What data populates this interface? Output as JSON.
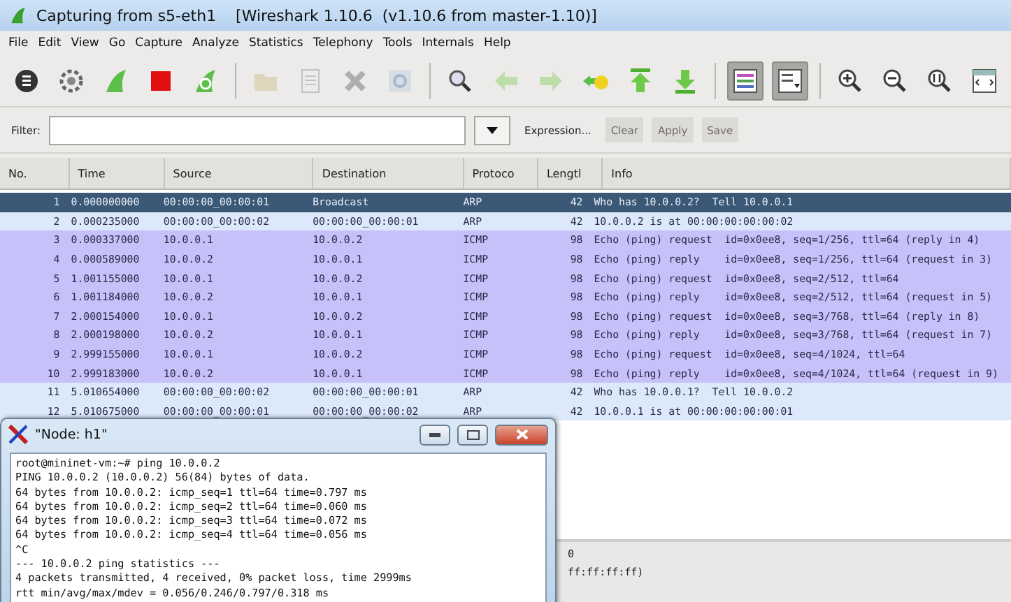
{
  "window": {
    "title": "Capturing from s5-eth1    [Wireshark 1.10.6  (v1.10.6 from master-1.10)]"
  },
  "menu": [
    "File",
    "Edit",
    "View",
    "Go",
    "Capture",
    "Analyze",
    "Statistics",
    "Telephony",
    "Tools",
    "Internals",
    "Help"
  ],
  "toolbar": [
    {
      "kind": "interfaces",
      "disabled": false,
      "on": false
    },
    {
      "kind": "options",
      "disabled": false,
      "on": false
    },
    {
      "kind": "start",
      "disabled": false,
      "on": false
    },
    {
      "kind": "stop",
      "disabled": false,
      "on": false
    },
    {
      "kind": "restart",
      "disabled": false,
      "on": false
    },
    {
      "kind": "sep"
    },
    {
      "kind": "open",
      "disabled": true,
      "on": false
    },
    {
      "kind": "save",
      "disabled": true,
      "on": false
    },
    {
      "kind": "close",
      "disabled": true,
      "on": false
    },
    {
      "kind": "reload",
      "disabled": true,
      "on": false
    },
    {
      "kind": "sep"
    },
    {
      "kind": "find",
      "disabled": false,
      "on": false
    },
    {
      "kind": "back",
      "disabled": true,
      "on": false
    },
    {
      "kind": "forward",
      "disabled": true,
      "on": false
    },
    {
      "kind": "goto",
      "disabled": false,
      "on": false
    },
    {
      "kind": "first",
      "disabled": false,
      "on": false
    },
    {
      "kind": "last",
      "disabled": false,
      "on": false
    },
    {
      "kind": "sep"
    },
    {
      "kind": "colorize",
      "disabled": false,
      "on": true
    },
    {
      "kind": "autoscroll",
      "disabled": false,
      "on": true
    },
    {
      "kind": "sep"
    },
    {
      "kind": "zoomin",
      "disabled": false,
      "on": false
    },
    {
      "kind": "zoomout",
      "disabled": false,
      "on": false
    },
    {
      "kind": "zoomreset",
      "disabled": false,
      "on": false
    },
    {
      "kind": "resize",
      "disabled": false,
      "on": false
    }
  ],
  "filter": {
    "label": "Filter:",
    "buttons": [
      {
        "label": "Expression...",
        "disabled": false
      },
      {
        "label": "Clear",
        "disabled": true
      },
      {
        "label": "Apply",
        "disabled": true
      },
      {
        "label": "Save",
        "disabled": true
      }
    ]
  },
  "table": {
    "columns": [
      "No.",
      "Time",
      "Source",
      "Destination",
      "Protoco",
      "Lengtl",
      "Info"
    ],
    "rows": [
      {
        "kind": "arp",
        "selected": true,
        "cells": [
          "1",
          "0.000000000",
          "00:00:00_00:00:01",
          "Broadcast",
          "ARP",
          "42",
          "Who has 10.0.0.2?  Tell 10.0.0.1"
        ]
      },
      {
        "kind": "arp",
        "selected": false,
        "cells": [
          "2",
          "0.000235000",
          "00:00:00_00:00:02",
          "00:00:00_00:00:01",
          "ARP",
          "42",
          "10.0.0.2 is at 00:00:00:00:00:02"
        ]
      },
      {
        "kind": "icmp",
        "selected": false,
        "cells": [
          "3",
          "0.000337000",
          "10.0.0.1",
          "10.0.0.2",
          "ICMP",
          "98",
          "Echo (ping) request  id=0x0ee8, seq=1/256, ttl=64 (reply in 4)"
        ]
      },
      {
        "kind": "icmp",
        "selected": false,
        "cells": [
          "4",
          "0.000589000",
          "10.0.0.2",
          "10.0.0.1",
          "ICMP",
          "98",
          "Echo (ping) reply    id=0x0ee8, seq=1/256, ttl=64 (request in 3)"
        ]
      },
      {
        "kind": "icmp",
        "selected": false,
        "cells": [
          "5",
          "1.001155000",
          "10.0.0.1",
          "10.0.0.2",
          "ICMP",
          "98",
          "Echo (ping) request  id=0x0ee8, seq=2/512, ttl=64"
        ]
      },
      {
        "kind": "icmp",
        "selected": false,
        "cells": [
          "6",
          "1.001184000",
          "10.0.0.2",
          "10.0.0.1",
          "ICMP",
          "98",
          "Echo (ping) reply    id=0x0ee8, seq=2/512, ttl=64 (request in 5)"
        ]
      },
      {
        "kind": "icmp",
        "selected": false,
        "cells": [
          "7",
          "2.000154000",
          "10.0.0.1",
          "10.0.0.2",
          "ICMP",
          "98",
          "Echo (ping) request  id=0x0ee8, seq=3/768, ttl=64 (reply in 8)"
        ]
      },
      {
        "kind": "icmp",
        "selected": false,
        "cells": [
          "8",
          "2.000198000",
          "10.0.0.2",
          "10.0.0.1",
          "ICMP",
          "98",
          "Echo (ping) reply    id=0x0ee8, seq=3/768, ttl=64 (request in 7)"
        ]
      },
      {
        "kind": "icmp",
        "selected": false,
        "cells": [
          "9",
          "2.999155000",
          "10.0.0.1",
          "10.0.0.2",
          "ICMP",
          "98",
          "Echo (ping) request  id=0x0ee8, seq=4/1024, ttl=64"
        ]
      },
      {
        "kind": "icmp",
        "selected": false,
        "cells": [
          "10",
          "2.999183000",
          "10.0.0.2",
          "10.0.0.1",
          "ICMP",
          "98",
          "Echo (ping) reply    id=0x0ee8, seq=4/1024, ttl=64 (request in 9)"
        ]
      },
      {
        "kind": "arp",
        "selected": false,
        "cells": [
          "11",
          "5.010654000",
          "00:00:00_00:00:02",
          "00:00:00_00:00:01",
          "ARP",
          "42",
          "Who has 10.0.0.1?  Tell 10.0.0.2"
        ]
      },
      {
        "kind": "arp",
        "selected": false,
        "cells": [
          "12",
          "5.010675000",
          "00:00:00_00:00:01",
          "00:00:00_00:00:02",
          "ARP",
          "42",
          "10.0.0.1 is at 00:00:00:00:00:01"
        ]
      }
    ]
  },
  "details": [
    "0",
    "ff:ff:ff:ff)"
  ],
  "terminal": {
    "title": "\"Node: h1\"",
    "lines": [
      "root@mininet-vm:~# ping 10.0.0.2",
      "PING 10.0.0.2 (10.0.0.2) 56(84) bytes of data.",
      "64 bytes from 10.0.0.2: icmp_seq=1 ttl=64 time=0.797 ms",
      "64 bytes from 10.0.0.2: icmp_seq=2 ttl=64 time=0.060 ms",
      "64 bytes from 10.0.0.2: icmp_seq=3 ttl=64 time=0.072 ms",
      "64 bytes from 10.0.0.2: icmp_seq=4 ttl=64 time=0.056 ms",
      "^C",
      "--- 10.0.0.2 ping statistics ---",
      "4 packets transmitted, 4 received, 0% packet loss, time 2999ms",
      "rtt min/avg/max/mdev = 0.056/0.246/0.797/0.318 ms"
    ]
  }
}
